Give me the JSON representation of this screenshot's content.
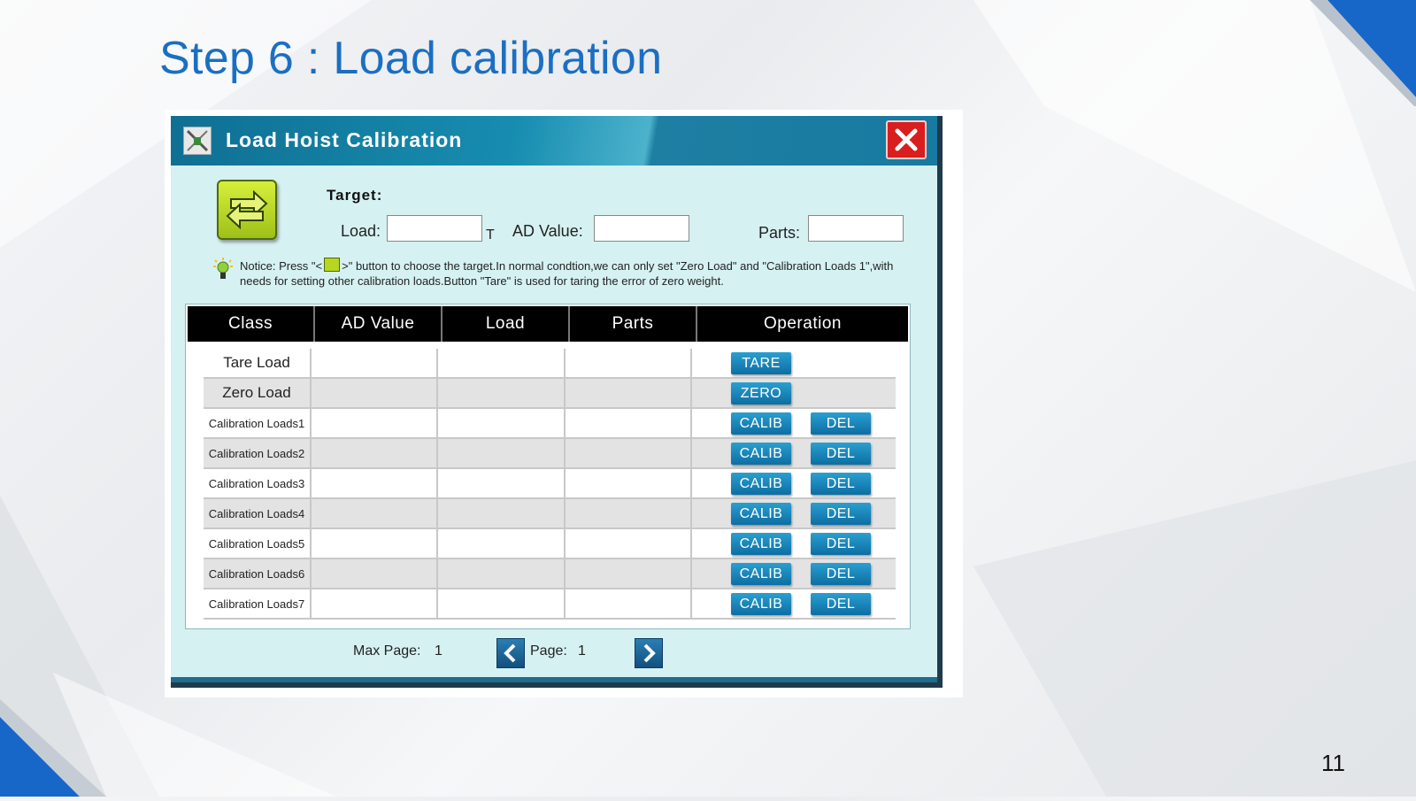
{
  "slide": {
    "title": "Step 6 : Load calibration",
    "page_number": "11",
    "accent_color": "#1b6fc2"
  },
  "window": {
    "title": "Load Hoist Calibration",
    "icons": {
      "app": "hoist-app-icon",
      "close": "close-icon",
      "swap": "swap-arrows-icon"
    }
  },
  "target": {
    "heading": "Target:",
    "load_label": "Load:",
    "load_value": "",
    "load_unit": "T",
    "ad_label": "AD Value:",
    "ad_value": "",
    "parts_label": "Parts:",
    "parts_value": ""
  },
  "notice": {
    "prefix": "Notice: Press \"<",
    "text": ">\" button to choose the target.In normal condtion,we can only set \"Zero Load\" and \"Calibration Loads 1\",with needs for setting other calibration loads.Button \"Tare\" is used for taring the error of zero weight."
  },
  "table": {
    "headers": [
      "Class",
      "AD Value",
      "Load",
      "Parts",
      "Operation"
    ],
    "rows": [
      {
        "class": "Tare Load",
        "ad": "",
        "load": "",
        "parts": "",
        "buttons": [
          "TARE"
        ]
      },
      {
        "class": "Zero Load",
        "ad": "",
        "load": "",
        "parts": "",
        "buttons": [
          "ZERO"
        ]
      },
      {
        "class": "Calibration Loads1",
        "ad": "",
        "load": "",
        "parts": "",
        "buttons": [
          "CALIB",
          "DEL"
        ]
      },
      {
        "class": "Calibration Loads2",
        "ad": "",
        "load": "",
        "parts": "",
        "buttons": [
          "CALIB",
          "DEL"
        ]
      },
      {
        "class": "Calibration Loads3",
        "ad": "",
        "load": "",
        "parts": "",
        "buttons": [
          "CALIB",
          "DEL"
        ]
      },
      {
        "class": "Calibration Loads4",
        "ad": "",
        "load": "",
        "parts": "",
        "buttons": [
          "CALIB",
          "DEL"
        ]
      },
      {
        "class": "Calibration Loads5",
        "ad": "",
        "load": "",
        "parts": "",
        "buttons": [
          "CALIB",
          "DEL"
        ]
      },
      {
        "class": "Calibration Loads6",
        "ad": "",
        "load": "",
        "parts": "",
        "buttons": [
          "CALIB",
          "DEL"
        ]
      },
      {
        "class": "Calibration Loads7",
        "ad": "",
        "load": "",
        "parts": "",
        "buttons": [
          "CALIB",
          "DEL"
        ]
      }
    ]
  },
  "pager": {
    "max_label": "Max Page:",
    "max_value": "1",
    "page_label": "Page:",
    "page_value": "1"
  }
}
